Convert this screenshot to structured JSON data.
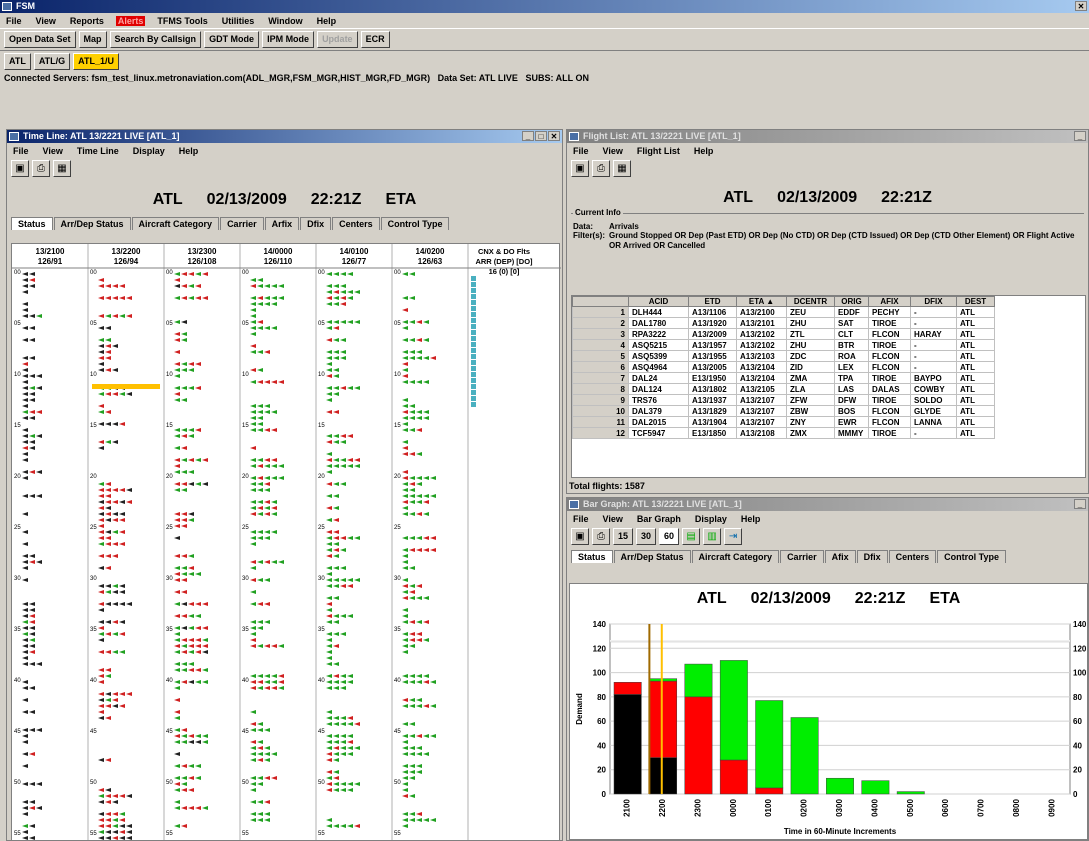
{
  "app": {
    "title": "FSM",
    "menus": [
      "File",
      "View",
      "Reports",
      "Alerts",
      "TFMS Tools",
      "Utilities",
      "Window",
      "Help"
    ],
    "toolbar": [
      "Open Data Set",
      "Map",
      "Search By Callsign",
      "GDT Mode",
      "IPM Mode",
      "Update",
      "ECR"
    ],
    "airport_tabs": [
      "ATL",
      "ATL/G",
      "ATL_1/U"
    ],
    "status_line": "Connected Servers: fsm_test_linux.metronaviation.com(ADL_MGR,FSM_MGR,HIST_MGR,FD_MGR)",
    "dataset": "Data Set: ATL LIVE",
    "subs": "SUBS: ALL ON"
  },
  "timeline": {
    "title": "Time Line: ATL 13/2221 LIVE [ATL_1]",
    "menus": [
      "File",
      "View",
      "Time Line",
      "Display",
      "Help"
    ],
    "header": {
      "airport": "ATL",
      "date": "02/13/2009",
      "time": "22:21Z",
      "mode": "ETA"
    },
    "tabs": [
      "Status",
      "Arr/Dep Status",
      "Aircraft Category",
      "Carrier",
      "Arfix",
      "Dfix",
      "Centers",
      "Control Type"
    ],
    "columns": [
      {
        "time": "13/2100",
        "count": "126/91"
      },
      {
        "time": "13/2200",
        "count": "126/94"
      },
      {
        "time": "13/2300",
        "count": "126/108"
      },
      {
        "time": "14/0000",
        "count": "126/110"
      },
      {
        "time": "14/0100",
        "count": "126/77"
      },
      {
        "time": "14/0200",
        "count": "126/63"
      }
    ],
    "cnx_header": [
      "CNX & DO Flts",
      "ARR (DEP) [DO]",
      "16 (0) [0]"
    ],
    "row_labels": [
      "00",
      "05",
      "10",
      "15",
      "20",
      "25",
      "30",
      "35",
      "40",
      "45",
      "50",
      "55"
    ]
  },
  "flightlist": {
    "title": "Flight List: ATL 13/2221 LIVE [ATL_1]",
    "menus": [
      "File",
      "View",
      "Flight List",
      "Help"
    ],
    "header": {
      "airport": "ATL",
      "date": "02/13/2009",
      "time": "22:21Z"
    },
    "current_info_label": "Current Info",
    "data_label": "Data:",
    "data_value": "Arrivals",
    "filter_label": "Filter(s):",
    "filter_value": "Ground Stopped OR Dep (Past ETD) OR Dep (No CTD) OR Dep (CTD Issued) OR Dep (CTD Other Element) OR Flight Active OR Arrived OR Cancelled",
    "columns": [
      "ACID",
      "ETD",
      "ETA ▲",
      "DCENTR",
      "ORIG",
      "AFIX",
      "DFIX",
      "DEST"
    ],
    "rows": [
      [
        "1",
        "DLH444",
        "A13/1106",
        "A13/2100",
        "ZEU",
        "EDDF",
        "PECHY",
        "-",
        "ATL"
      ],
      [
        "2",
        "DAL1780",
        "A13/1920",
        "A13/2101",
        "ZHU",
        "SAT",
        "TIROE",
        "-",
        "ATL"
      ],
      [
        "3",
        "RPA3222",
        "A13/2009",
        "A13/2102",
        "ZTL",
        "CLT",
        "FLCON",
        "HARAY",
        "ATL"
      ],
      [
        "4",
        "ASQ5215",
        "A13/1957",
        "A13/2102",
        "ZHU",
        "BTR",
        "TIROE",
        "-",
        "ATL"
      ],
      [
        "5",
        "ASQ5399",
        "A13/1955",
        "A13/2103",
        "ZDC",
        "ROA",
        "FLCON",
        "-",
        "ATL"
      ],
      [
        "6",
        "ASQ4964",
        "A13/2005",
        "A13/2104",
        "ZID",
        "LEX",
        "FLCON",
        "-",
        "ATL"
      ],
      [
        "7",
        "DAL24",
        "E13/1950",
        "A13/2104",
        "ZMA",
        "TPA",
        "TIROE",
        "BAYPO",
        "ATL"
      ],
      [
        "8",
        "DAL124",
        "A13/1802",
        "A13/2105",
        "ZLA",
        "LAS",
        "DALAS",
        "COWBY",
        "ATL"
      ],
      [
        "9",
        "TRS76",
        "A13/1937",
        "A13/2107",
        "ZFW",
        "DFW",
        "TIROE",
        "SOLDO",
        "ATL"
      ],
      [
        "10",
        "DAL379",
        "A13/1829",
        "A13/2107",
        "ZBW",
        "BOS",
        "FLCON",
        "GLYDE",
        "ATL"
      ],
      [
        "11",
        "DAL2015",
        "A13/1904",
        "A13/2107",
        "ZNY",
        "EWR",
        "FLCON",
        "LANNA",
        "ATL"
      ],
      [
        "12",
        "TCF5947",
        "E13/1850",
        "A13/2108",
        "ZMX",
        "MMMY",
        "TIROE",
        "-",
        "ATL"
      ]
    ],
    "total": "Total flights: 1587"
  },
  "bargraph": {
    "title": "Bar Graph: ATL 13/2221 LIVE [ATL_1]",
    "menus": [
      "File",
      "View",
      "Bar Graph",
      "Display",
      "Help"
    ],
    "intervals": [
      "15",
      "30",
      "60"
    ],
    "header": {
      "airport": "ATL",
      "date": "02/13/2009",
      "time": "22:21Z",
      "mode": "ETA"
    },
    "tabs": [
      "Status",
      "Arr/Dep Status",
      "Aircraft Category",
      "Carrier",
      "Afix",
      "Dfix",
      "Centers",
      "Control Type"
    ]
  },
  "chart_data": {
    "type": "bar",
    "categories": [
      "2100",
      "2200",
      "2300",
      "0000",
      "0100",
      "0200",
      "0300",
      "0400",
      "0500",
      "0600",
      "0700",
      "0800",
      "0900"
    ],
    "series": [
      {
        "values": [
          82,
          30,
          0,
          0,
          0,
          0,
          0,
          0,
          0,
          0,
          0,
          0,
          0
        ]
      },
      {
        "values": [
          10,
          63,
          80,
          28,
          5,
          0,
          0,
          0,
          0,
          0,
          0,
          0,
          0
        ]
      },
      {
        "values": [
          0,
          2,
          27,
          82,
          72,
          63,
          13,
          11,
          2,
          0,
          0,
          0,
          0
        ]
      }
    ],
    "ylabel": "Demand",
    "xlabel": "Time in 60-Minute Increments",
    "ylim": [
      0,
      140
    ],
    "yticks": [
      0,
      20,
      40,
      60,
      80,
      100,
      120,
      140
    ],
    "capacity_line": 126,
    "now_markers": [
      "2200",
      "2221"
    ],
    "colors": {
      "black": "#000000",
      "red": "#ff0000",
      "green": "#00ee00",
      "capacity": "#ffffff",
      "marker_brown": "#a06a00",
      "marker_yellow": "#ffc000"
    }
  }
}
